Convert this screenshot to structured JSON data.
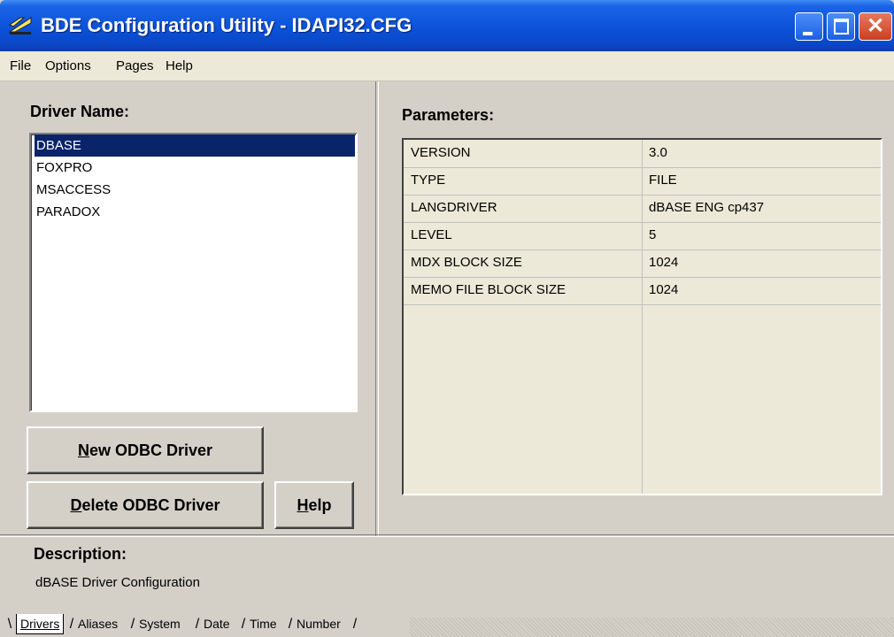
{
  "window": {
    "title": "BDE Configuration Utility - IDAPI32.CFG"
  },
  "menu": [
    "File",
    "Options",
    "Pages",
    "Help"
  ],
  "left": {
    "driver_label": "Driver Name:",
    "drivers": [
      "DBASE",
      "FOXPRO",
      "MSACCESS",
      "PARADOX"
    ],
    "selected_driver": "DBASE",
    "new_btn": {
      "mnemonic": "N",
      "rest": "ew ODBC Driver"
    },
    "delete_btn": {
      "mnemonic": "D",
      "rest": "elete ODBC Driver"
    },
    "help_btn": {
      "mnemonic": "H",
      "rest": "elp"
    }
  },
  "right": {
    "params_label": "Parameters:",
    "params": [
      {
        "name": "VERSION",
        "value": "3.0"
      },
      {
        "name": "TYPE",
        "value": "FILE"
      },
      {
        "name": "LANGDRIVER",
        "value": "dBASE ENG cp437"
      },
      {
        "name": "LEVEL",
        "value": "5"
      },
      {
        "name": "MDX BLOCK SIZE",
        "value": "1024"
      },
      {
        "name": "MEMO FILE BLOCK SIZE",
        "value": "1024"
      }
    ]
  },
  "description": {
    "label": "Description:",
    "text": "dBASE Driver Configuration"
  },
  "tabs": [
    "Drivers",
    "Aliases",
    "System",
    "Date",
    "Time",
    "Number"
  ],
  "active_tab": "Drivers"
}
